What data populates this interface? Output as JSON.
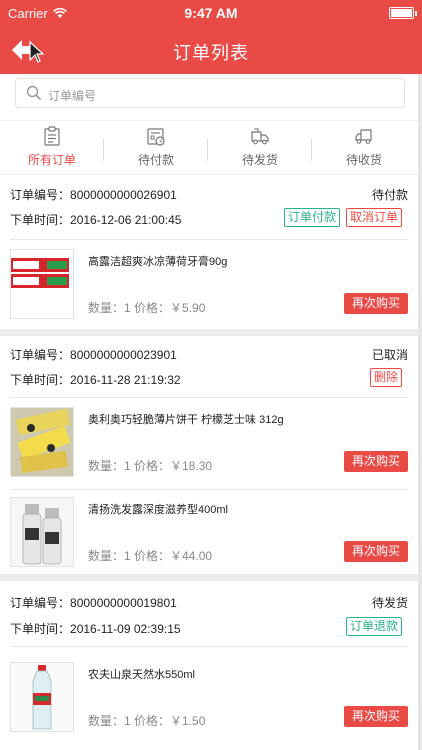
{
  "status_bar": {
    "carrier": "Carrier",
    "time": "9:47 AM"
  },
  "nav": {
    "title": "订单列表"
  },
  "search": {
    "placeholder": "订单编号"
  },
  "tabs": [
    {
      "label": "所有订单",
      "icon": "clipboard-icon",
      "active": true
    },
    {
      "label": "待付款",
      "icon": "wallet-icon",
      "active": false
    },
    {
      "label": "待发货",
      "icon": "package-truck-icon",
      "active": false
    },
    {
      "label": "待收货",
      "icon": "truck-icon",
      "active": false
    }
  ],
  "labels": {
    "order_no": "订单编号：",
    "order_time": "下单时间："
  },
  "orders": [
    {
      "number": "8000000000026901",
      "time": "2016-12-06 21:00:45",
      "status": "待付款",
      "actions": [
        "订单付款",
        "取消订单"
      ],
      "items": [
        {
          "name": "高露洁超爽冰凉薄荷牙膏90g",
          "qty_price": "数量：1 价格：￥5.90",
          "buy": "再次购买"
        }
      ]
    },
    {
      "number": "8000000000023901",
      "time": "2016-11-28 21:19:32",
      "status": "已取消",
      "actions": [
        "删除"
      ],
      "items": [
        {
          "name": "奥利奥巧轻脆薄片饼干 柠檬芝士味 312g",
          "qty_price": "数量：1 价格：￥18.30",
          "buy": "再次购买"
        },
        {
          "name": "清扬洗发露深度滋养型400ml",
          "qty_price": "数量：1 价格：￥44.00",
          "buy": "再次购买"
        }
      ]
    },
    {
      "number": "8000000000019801",
      "time": "2016-11-09 02:39:15",
      "status": "待发货",
      "actions": [
        "订单退款"
      ],
      "items": [
        {
          "name": "农夫山泉天然水550ml",
          "qty_price": "数量：1 价格：￥1.50",
          "buy": "再次购买"
        }
      ]
    }
  ],
  "colors": {
    "brand": "#e94a46",
    "green": "#2bb389"
  }
}
